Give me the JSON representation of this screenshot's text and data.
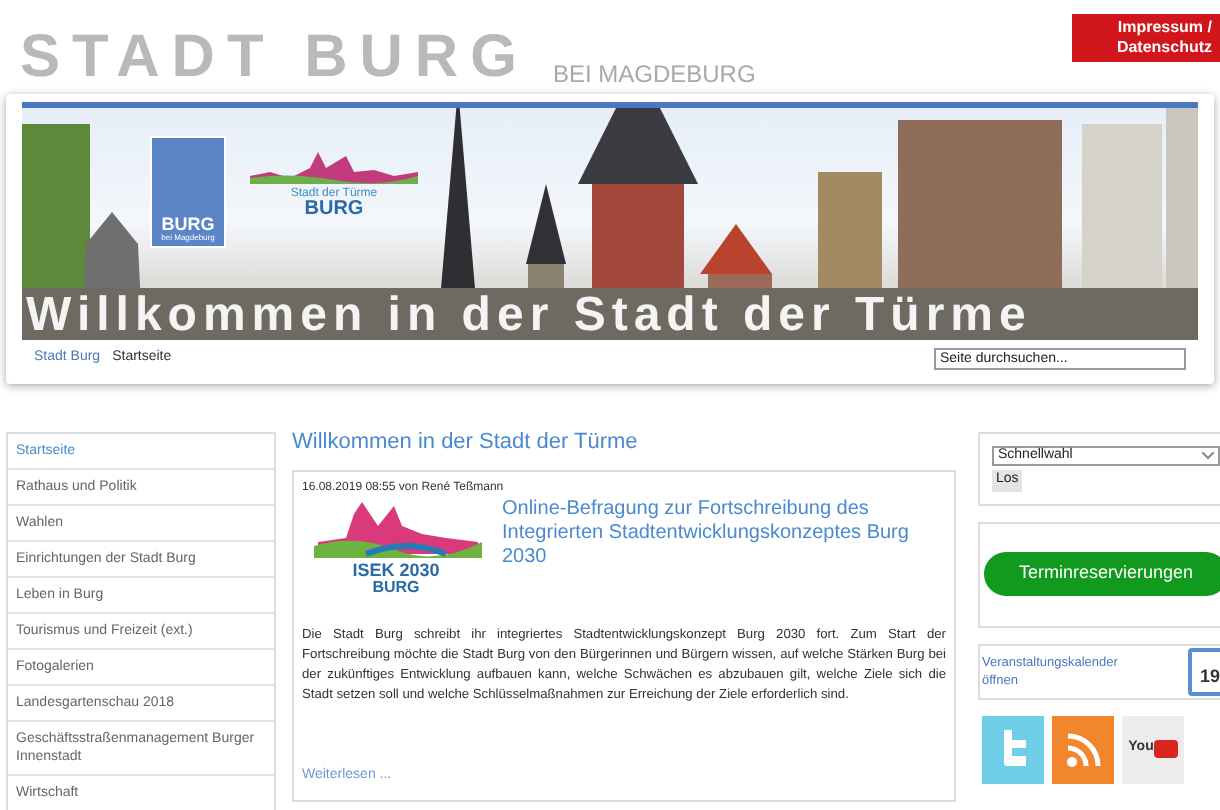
{
  "header": {
    "site_title": "STADT BURG",
    "site_subtitle": "BEI MAGDEBURG",
    "corner_link": "Impressum / Datenschutz",
    "banner": {
      "logo_city": "BURG",
      "logo_city_sub": "bei Magdeburg",
      "logo_towers": "Stadt der Türme",
      "logo_towers_name": "BURG",
      "caption": "Willkommen in der Stadt der Türme"
    }
  },
  "breadcrumb": [
    {
      "label": "Stadt Burg",
      "kind": "link"
    },
    {
      "label": "Startseite",
      "kind": "current"
    }
  ],
  "search": {
    "value": "Seite durchsuchen..."
  },
  "nav": [
    {
      "label": "Startseite",
      "selected": true
    },
    {
      "label": "Rathaus und Politik",
      "selected": false
    },
    {
      "label": "Wahlen",
      "selected": false
    },
    {
      "label": "Einrichtungen der Stadt Burg",
      "selected": false
    },
    {
      "label": "Leben in Burg",
      "selected": false
    },
    {
      "label": "Tourismus und Freizeit (ext.)",
      "selected": false
    },
    {
      "label": "Fotogalerien",
      "selected": false
    },
    {
      "label": "Landesgartenschau 2018",
      "selected": false
    },
    {
      "label": "Geschäftsstraßenmanagement Burger Innenstadt",
      "selected": false
    },
    {
      "label": "Wirtschaft",
      "selected": false
    }
  ],
  "main": {
    "heading": "Willkommen in der Stadt der Türme",
    "article": {
      "meta": "16.08.2019 08:55 von René Teßmann",
      "image_text": "ISEK 2030",
      "image_text2": "BURG",
      "title": "Online-Befragung zur Fortschreibung des Integrierten Stadtentwicklungskonzeptes Burg 2030",
      "body": "Die Stadt Burg schreibt ihr integriertes Stadtentwicklungskonzept Burg 2030 fort. Zum Start der Fortschreibung möchte die Stadt Burg von den Bürgerinnen und Bürgern wissen, auf welche Stärken Burg bei der zukünftiges Entwicklung aufbauen kann, welche Schwächen es abzubauen gilt, welche Ziele sich die Stadt setzen soll und welche Schlüsselmaßnahmen zur Erreichung der Ziele erforderlich sind.",
      "more": "Weiterlesen ..."
    }
  },
  "sidebar": {
    "quick_select": {
      "value": "Schnellwahl",
      "button": "Los"
    },
    "appointment_button": "Terminreservierungen",
    "calendar": {
      "label": "Veranstaltungskalender öffnen",
      "day": "19"
    },
    "social": [
      {
        "kind": "twitter"
      },
      {
        "kind": "rss"
      },
      {
        "kind": "youtube",
        "label": "You"
      }
    ]
  }
}
